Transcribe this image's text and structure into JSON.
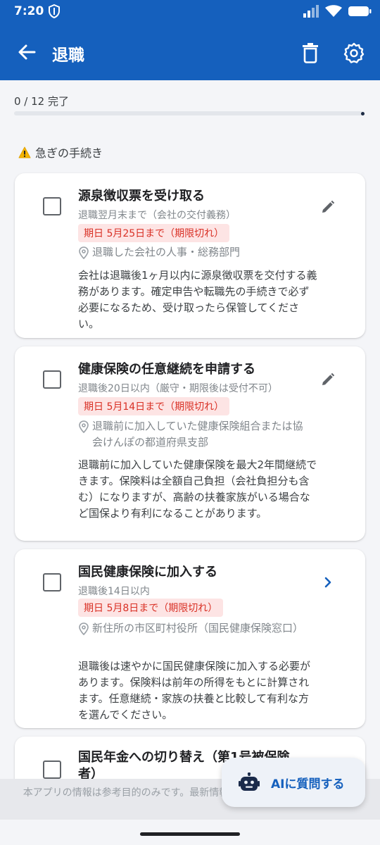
{
  "status_bar": {
    "time": "7:20"
  },
  "app_bar": {
    "title": "退職"
  },
  "progress": {
    "label": "0 / 12 完了",
    "completed": 0,
    "total": 12
  },
  "section": {
    "label": "急ぎの手続き"
  },
  "tasks": [
    {
      "title": "源泉徴収票を受け取る",
      "subtitle": "退職翌月末まで（会社の交付義務）",
      "deadline": "期日 5月25日まで（期限切れ）",
      "location": "退職した会社の人事・総務部門",
      "description": "会社は退職後1ヶ月以内に源泉徴収票を交付する義務があります。確定申告や転職先の手続きで必ず必要になるため、受け取ったら保管してください。",
      "action_icon": "pencil-icon"
    },
    {
      "title": "健康保険の任意継続を申請する",
      "subtitle": "退職後20日以内（厳守・期限後は受付不可）",
      "deadline": "期日 5月14日まで（期限切れ）",
      "location": "退職前に加入していた健康保険組合または協会けんぽの都道府県支部",
      "description": "退職前に加入していた健康保険を最大2年間継続できます。保険料は全額自己負担（会社負担分も含む）になりますが、高齢の扶養家族がいる場合など国保より有利になることがあります。",
      "action_icon": "pencil-icon"
    },
    {
      "title": "国民健康保険に加入する",
      "subtitle": "退職後14日以内",
      "deadline": "期日 5月8日まで（期限切れ）",
      "location": "新住所の市区町村役所（国民健康保険窓口）",
      "description": "退職後は速やかに国民健康保険に加入する必要があります。保険料は前年の所得をもとに計算されます。任意継続・家族の扶養と比較して有利な方を選んでください。",
      "action_icon": "chevron-right-icon"
    },
    {
      "title": "国民年金への切り替え（第1号被保険者）"
    }
  ],
  "disclaimer": "本アプリの情報は参考目的のみです。最新情報は各窓口でご確認ください。",
  "fab": {
    "label": "AIに質問する"
  },
  "colors": {
    "primary": "#1560bd",
    "overdue_bg": "#fde4e4",
    "overdue_text": "#d93025"
  }
}
